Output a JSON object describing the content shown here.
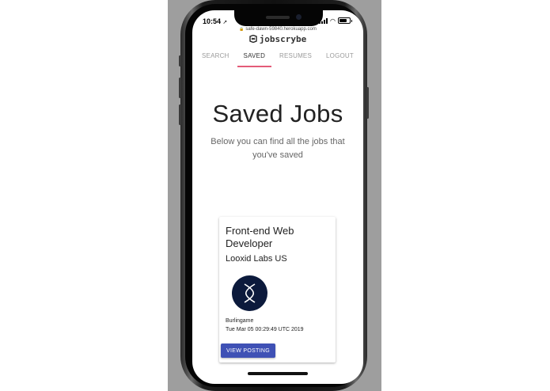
{
  "status_bar": {
    "time": "10:54"
  },
  "browser": {
    "url": "safe-dawn-59840.herokuapp.com"
  },
  "app": {
    "brand": "jobscrybe"
  },
  "nav": {
    "tabs": [
      {
        "label": "SEARCH",
        "active": false
      },
      {
        "label": "SAVED",
        "active": true
      },
      {
        "label": "RESUMES",
        "active": false
      },
      {
        "label": "LOGOUT",
        "active": false
      }
    ]
  },
  "page": {
    "title": "Saved Jobs",
    "subtitle": "Below you can find all the jobs that you've saved"
  },
  "jobs": [
    {
      "title": "Front-end Web Developer",
      "company": "Looxid Labs US",
      "location": "Burlingame",
      "posted": "Tue Mar 05 00:29:49 UTC 2019",
      "action_label": "VIEW POSTING"
    }
  ],
  "colors": {
    "accent": "#3f51b5",
    "tab_indicator": "#e45b78",
    "company_logo_bg": "#0c1a3c"
  }
}
